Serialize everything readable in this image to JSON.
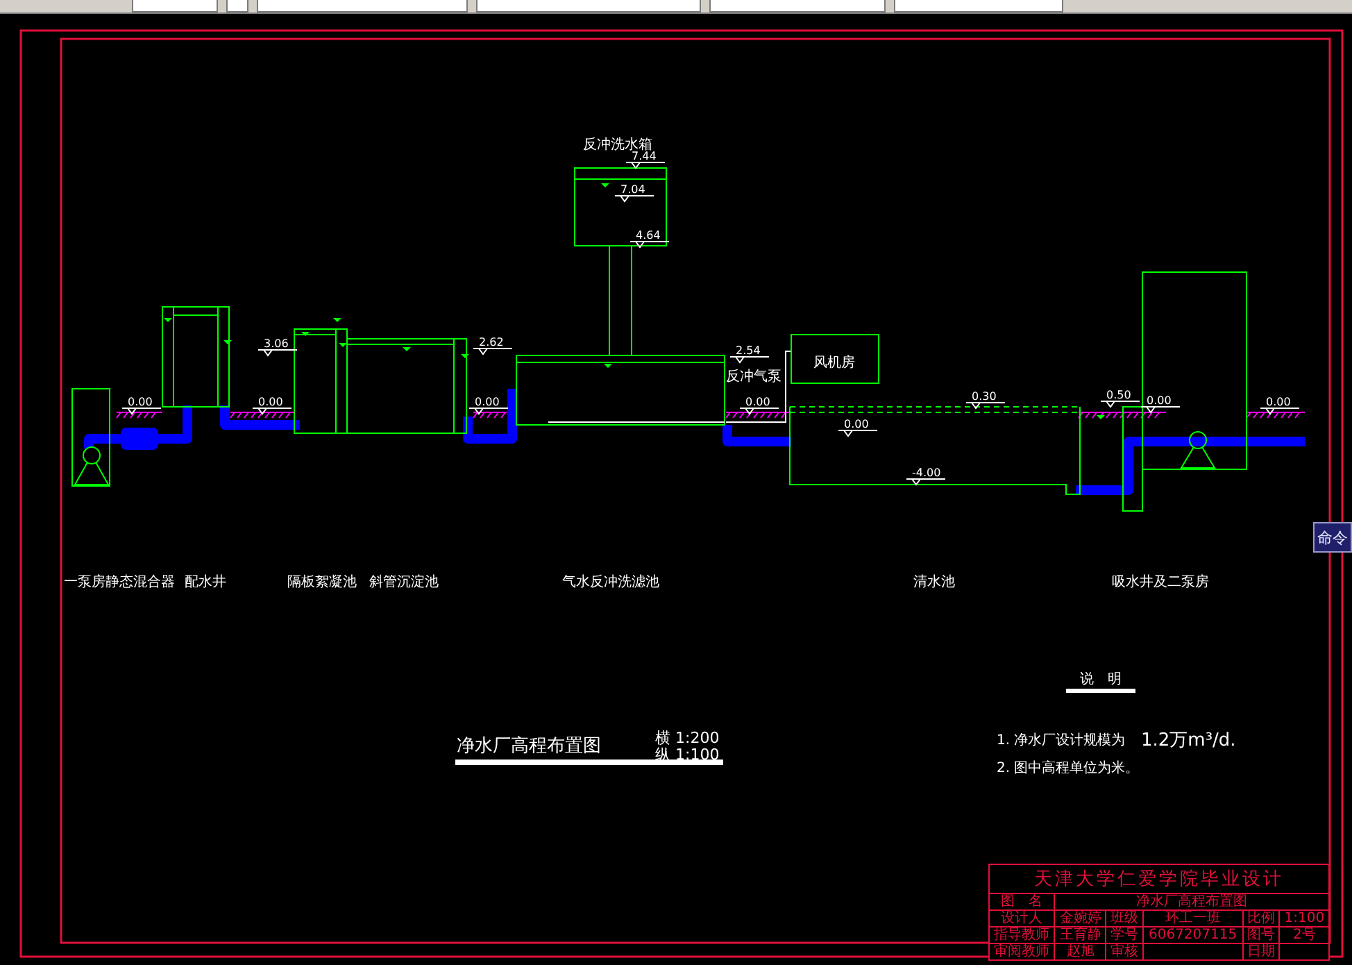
{
  "command_button": {
    "label": "命令"
  },
  "drawing": {
    "elevations": [
      {
        "value": "7.44"
      },
      {
        "value": "7.04"
      },
      {
        "value": "4.64"
      },
      {
        "value": "3.06"
      },
      {
        "value": "2.62"
      },
      {
        "value": "2.54"
      },
      {
        "value": "0.00"
      },
      {
        "value": "0.00"
      },
      {
        "value": "0.00"
      },
      {
        "value": "0.00"
      },
      {
        "value": "0.30"
      },
      {
        "value": "0.00"
      },
      {
        "value": "0.50"
      },
      {
        "value": "-4.00"
      },
      {
        "value": "0.00"
      },
      {
        "value": "0.00"
      }
    ],
    "annotations": [
      {
        "label": "反冲洗水箱"
      },
      {
        "label": "反冲气泵"
      },
      {
        "label": "风机房"
      }
    ],
    "structures": [
      {
        "label": "一泵房"
      },
      {
        "label": "静态混合器"
      },
      {
        "label": "配水井"
      },
      {
        "label": "隔板絮凝池"
      },
      {
        "label": "斜管沉淀池"
      },
      {
        "label": "气水反冲洗滤池"
      },
      {
        "label": "清水池"
      },
      {
        "label": "吸水井及二泵房"
      }
    ],
    "title": "净水厂高程布置图",
    "scales": [
      "横 1:200",
      "纵 1:100"
    ],
    "notes": {
      "heading": "说　明",
      "items": [
        {
          "text": "1. 净水厂设计规模为",
          "value": "1.2万m³/d."
        },
        {
          "text": "2. 图中高程单位为米。"
        }
      ]
    },
    "title_block": {
      "heading": "天津大学仁爱学院毕业设计",
      "rows": [
        [
          {
            "text": "图　名"
          },
          {
            "text": "净水厂高程布置图",
            "colspan": 5
          }
        ],
        [
          {
            "text": "设计人"
          },
          {
            "text": "金婉婷"
          },
          {
            "text": "班级"
          },
          {
            "text": "环工一班"
          },
          {
            "text": "比例"
          },
          {
            "text": "1:100"
          }
        ],
        [
          {
            "text": "指导教师"
          },
          {
            "text": "王育静"
          },
          {
            "text": "学号"
          },
          {
            "text": "6067207115"
          },
          {
            "text": "图号"
          },
          {
            "text": "2号"
          }
        ],
        [
          {
            "text": "审阅教师"
          },
          {
            "text": "赵旭"
          },
          {
            "text": "审核"
          },
          {
            "text": ""
          },
          {
            "text": "日期"
          },
          {
            "text": ""
          }
        ]
      ]
    }
  }
}
